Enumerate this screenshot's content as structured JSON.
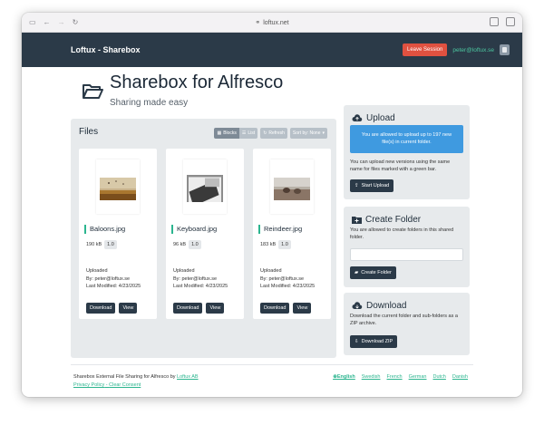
{
  "browser": {
    "url": "loftux.net"
  },
  "navbar": {
    "brand": "Loftux - Sharebox",
    "leave_label": "Leave Session",
    "user_email": "peter@loftux.se"
  },
  "hero": {
    "title": "Sharebox for Alfresco",
    "subtitle": "Sharing made easy"
  },
  "files": {
    "title": "Files",
    "toolbar": {
      "blocks": "Blocks",
      "list": "List",
      "refresh": "Refresh",
      "sort": "Sort by: None"
    },
    "items": [
      {
        "name": "Baloons.jpg",
        "size": "190 kB",
        "version": "1.0",
        "uploaded": "Uploaded",
        "by": "By: peter@loftux.se",
        "modified": "Last Modified: 4/23/2025",
        "download": "Download",
        "view": "View"
      },
      {
        "name": "Keyboard.jpg",
        "size": "96 kB",
        "version": "1.0",
        "uploaded": "Uploaded",
        "by": "By: peter@loftux.se",
        "modified": "Last Modified: 4/23/2025",
        "download": "Download",
        "view": "View"
      },
      {
        "name": "Reindeer.jpg",
        "size": "183 kB",
        "version": "1.0",
        "uploaded": "Uploaded",
        "by": "By: peter@loftux.se",
        "modified": "Last Modified: 4/23/2025",
        "download": "Download",
        "view": "View"
      }
    ]
  },
  "upload": {
    "title": "Upload",
    "alert": "You are allowed to upload up to 197 new file(s) in current folder.",
    "text": "You can upload new versions using the same name for files marked with a green bar.",
    "button": "Start Upload"
  },
  "create_folder": {
    "title": "Create Folder",
    "text": "You are allowed to create folders in this shared folder.",
    "input_value": "",
    "button": "Create Folder"
  },
  "download": {
    "title": "Download",
    "text": "Download the current folder and sub-folders as a ZIP archive.",
    "button": "Download ZIP"
  },
  "footer": {
    "line1_prefix": "Sharebox External File Sharing for Alfresco by ",
    "line1_link": "Loftux AB",
    "privacy": "Privacy Policy",
    "sep": " - ",
    "consent": "Clear Consent",
    "languages": [
      "English",
      "Swedish",
      "French",
      "German",
      "Dutch",
      "Danish"
    ]
  },
  "colors": {
    "navbar": "#2b3a48",
    "accent_green": "#2cb58f",
    "alert_blue": "#3f9ae0",
    "leave_red": "#e05140",
    "panel": "#e7eaec"
  }
}
